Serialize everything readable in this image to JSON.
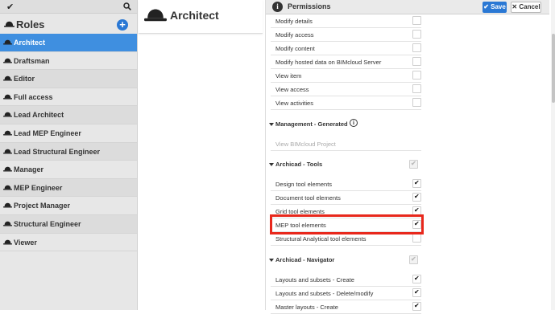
{
  "sidebar": {
    "title": "Roles",
    "items": [
      {
        "label": "Architect",
        "active": true
      },
      {
        "label": "Draftsman"
      },
      {
        "label": "Editor"
      },
      {
        "label": "Full access"
      },
      {
        "label": "Lead Architect"
      },
      {
        "label": "Lead MEP Engineer"
      },
      {
        "label": "Lead Structural Engineer"
      },
      {
        "label": "Manager"
      },
      {
        "label": "MEP Engineer"
      },
      {
        "label": "Project Manager"
      },
      {
        "label": "Structural Engineer"
      },
      {
        "label": "Viewer"
      }
    ]
  },
  "role": {
    "title": "Architect"
  },
  "panel": {
    "title": "Permissions",
    "save_label": "Save",
    "cancel_label": "Cancel"
  },
  "permissions": {
    "modify_details": "Modify details",
    "modify_access": "Modify access",
    "modify_content": "Modify content",
    "modify_hosted": "Modify hosted data on BIMcloud Server",
    "view_item": "View item",
    "view_access": "View access",
    "view_activities": "View activities",
    "mgmt_generated": "Management - Generated",
    "view_bimcloud_project": "View BIMcloud Project",
    "archicad_tools": "Archicad - Tools",
    "design_tool": "Design tool elements",
    "document_tool": "Document tool elements",
    "grid_tool": "Grid tool elements",
    "mep_tool": "MEP tool elements",
    "structural_tool": "Structural Analytical tool elements",
    "archicad_navigator": "Archicad - Navigator",
    "layouts_create": "Layouts and subsets - Create",
    "layouts_delete": "Layouts and subsets - Delete/modify",
    "master_create": "Master layouts - Create"
  }
}
